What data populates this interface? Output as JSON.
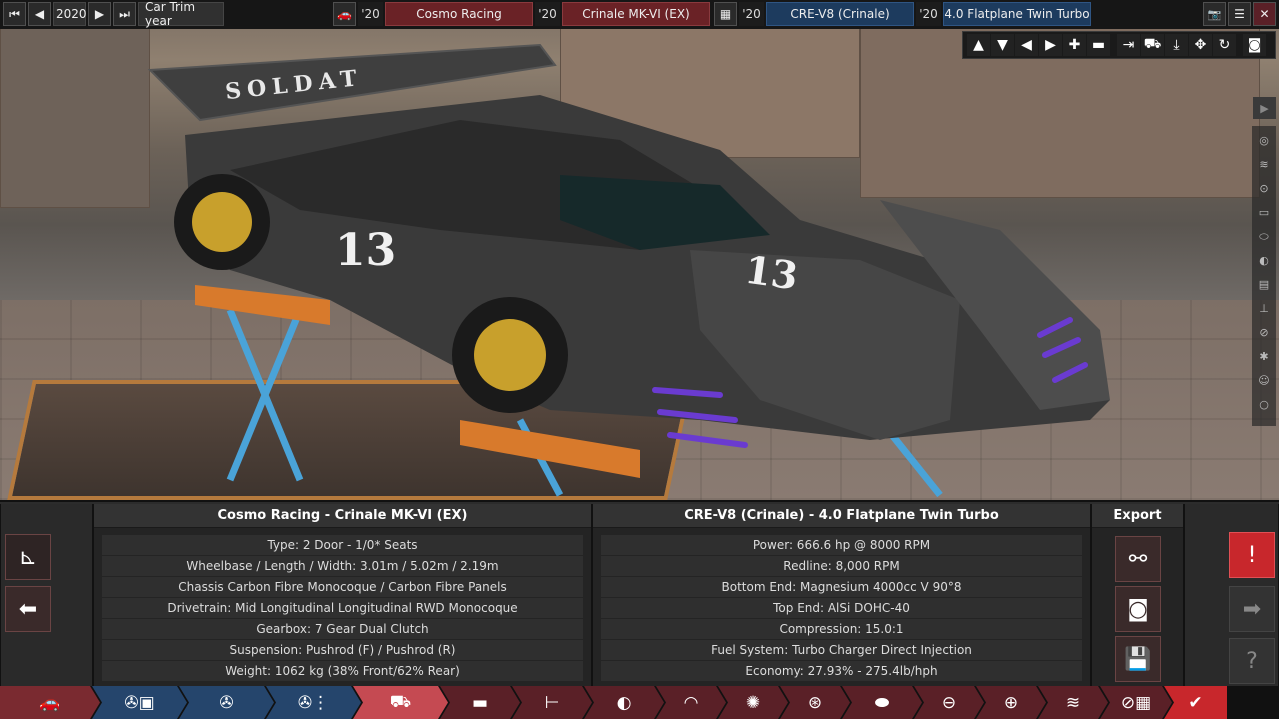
{
  "topbar": {
    "year": "2020",
    "trim_year_label": "Car Trim year",
    "model_year": "'20",
    "company": "Cosmo Racing",
    "trim_year": "'20",
    "model": "Crinale MK-VI (EX)",
    "engine_year": "'20",
    "engine_family": "CRE-V8 (Crinale)",
    "variant_year": "'20",
    "variant": "4.0 Flatplane Twin Turbo"
  },
  "car": {
    "wing_text": "SOLDAT",
    "number": "13"
  },
  "panel_left": {
    "title": "Cosmo Racing - Crinale MK-VI (EX)",
    "rows": [
      "Type: 2 Door - 1/0* Seats",
      "Wheelbase / Length / Width: 3.01m / 5.02m / 2.19m",
      "Chassis Carbon Fibre Monocoque / Carbon Fibre Panels",
      "Drivetrain: Mid Longitudinal Longitudinal RWD Monocoque",
      "Gearbox: 7 Gear Dual Clutch",
      "Suspension: Pushrod (F) / Pushrod (R)",
      "Weight: 1062 kg (38% Front/62% Rear)"
    ]
  },
  "panel_right": {
    "title": "CRE-V8 (Crinale) - 4.0 Flatplane Twin Turbo",
    "rows": [
      "Power: 666.6 hp @ 8000 RPM",
      "Redline:  8,000 RPM",
      "Bottom End: Magnesium 4000cc V 90°8",
      "Top End: AlSi DOHC-40",
      "Compression: 15.0:1",
      "Fuel System: Turbo Charger Direct Injection",
      "Economy: 27.93% - 275.4lb/hph"
    ]
  },
  "export": {
    "title": "Export"
  },
  "colors": {
    "accent_red": "#c8272c",
    "nav_red": "#7a2a30",
    "nav_blue": "#25456c",
    "nav_dark": "#5a2027"
  }
}
